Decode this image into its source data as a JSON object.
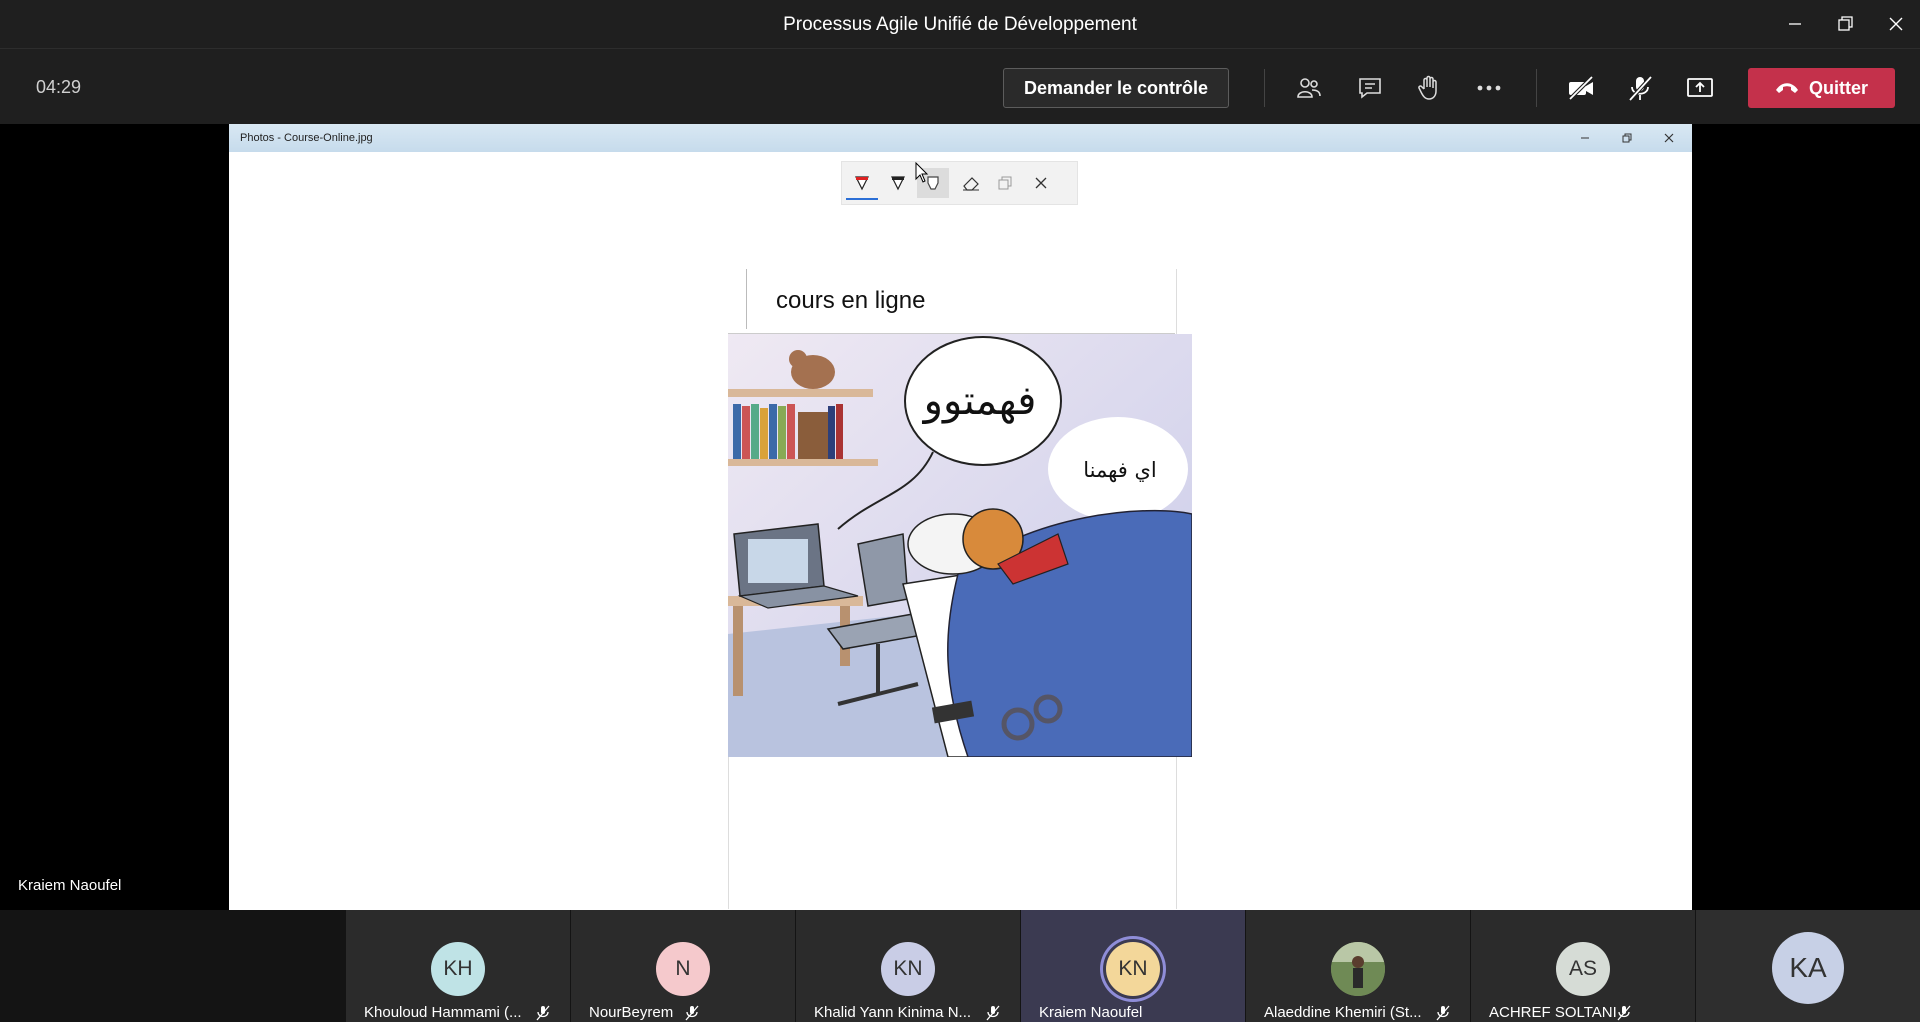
{
  "window": {
    "title": "Processus Agile Unifié de Développement"
  },
  "toolbar": {
    "timer": "04:29",
    "request_control_label": "Demander le contrôle",
    "quit_label": "Quitter"
  },
  "shared_window": {
    "title": "Photos - Course-Online.jpg",
    "image_heading": "cours en ligne",
    "bubble_main": "فهمتوو",
    "bubble_reply": "اي فهمنا"
  },
  "speaker_name": "Kraiem Naoufel",
  "participants": [
    {
      "initials": "KH",
      "name": "Khouloud Hammami (...",
      "color": "#bfe3e6"
    },
    {
      "initials": "N",
      "name": "NourBeyrem",
      "color": "#f5c9cc"
    },
    {
      "initials": "KN",
      "name": "Khalid Yann Kinima N...",
      "color": "#c9cde6"
    },
    {
      "initials": "KN",
      "name": "Kraiem Naoufel",
      "color": "#f3d79a"
    },
    {
      "initials": "",
      "name": "Alaeddine Khemiri (St...",
      "color": "#8a8a6a"
    },
    {
      "initials": "AS",
      "name": "ACHREF SOLTANI",
      "color": "#d6dcd6"
    }
  ],
  "self_avatar": "KA",
  "colors": {
    "quit": "#c4314b",
    "active_tile": "#3b3a51",
    "background": "#1f1f1f"
  }
}
